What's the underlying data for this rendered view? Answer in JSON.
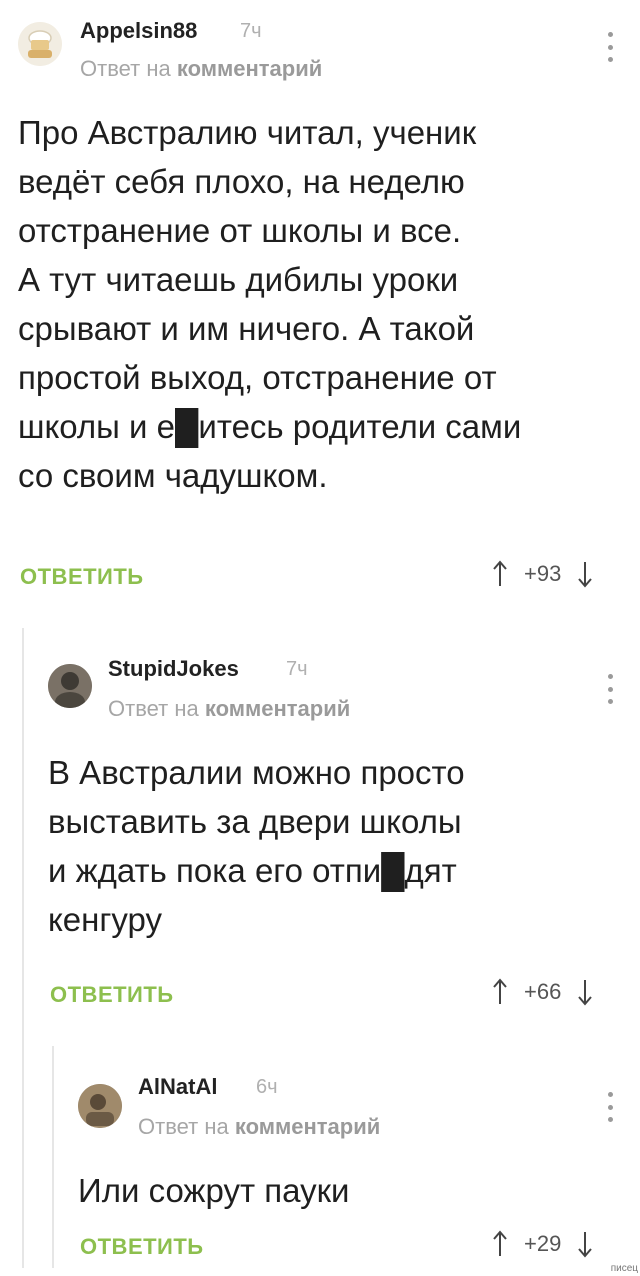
{
  "comments": [
    {
      "username": "Appelsin88",
      "time": "7ч",
      "reply_prefix": "Ответ на",
      "reply_target": "комментарий",
      "text": "Про Австралию читал, ученик\nведёт себя плохо, на неделю\nотстранение от школы и все.\nА тут читаешь дибилы уроки\nсрывают и им ничего. А такой\nпростой выход, отстранение от\nшколы и е█итесь родители сами\nсо своим чадушком.",
      "reply_label": "ОТВЕТИТЬ",
      "score": "+93"
    },
    {
      "username": "StupidJokes",
      "time": "7ч",
      "reply_prefix": "Ответ на",
      "reply_target": "комментарий",
      "text": "В Австралии можно просто\nвыставить за двери школы\nи ждать пока его отпи█дят\nкенгуру",
      "reply_label": "ОТВЕТИТЬ",
      "score": "+66"
    },
    {
      "username": "AlNatAl",
      "time": "6ч",
      "reply_prefix": "Ответ на",
      "reply_target": "комментарий",
      "text": "Или сожрут пауки",
      "reply_label": "ОТВЕТИТЬ",
      "score": "+29"
    }
  ],
  "watermark": "писец",
  "icons": {
    "menu": "more-vertical-icon",
    "upvote": "arrow-up-icon",
    "downvote": "arrow-down-icon"
  },
  "colors": {
    "reply_button": "#8dbf4e",
    "meta_text": "#a6a6a6",
    "thread_line": "#e6e6e6"
  }
}
